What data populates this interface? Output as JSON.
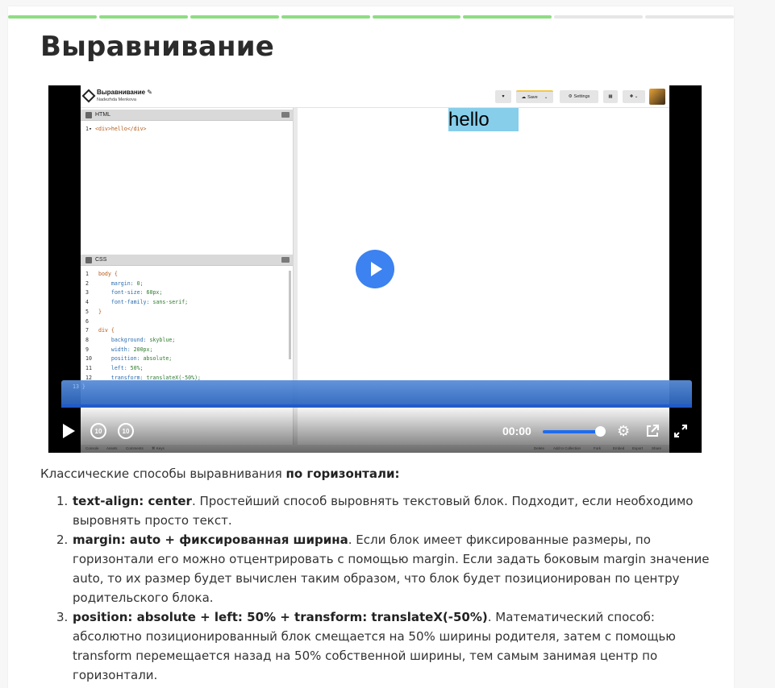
{
  "progress": {
    "segments": [
      "done",
      "done",
      "done",
      "done",
      "done",
      "done",
      "todo",
      "todo"
    ],
    "colors": {
      "done": "#8fdc84",
      "todo": "#e6e6e6"
    }
  },
  "title": "Выравнивание",
  "video": {
    "codepen": {
      "title": "Выравнивание",
      "author": "Nadezhda Menkova",
      "buttons": {
        "save": "Save",
        "settings": "Settings"
      },
      "html_pane": "HTML",
      "css_pane": "CSS",
      "html_code": [
        {
          "n": "1",
          "text": "<div>hello</div>"
        }
      ],
      "css_code": [
        {
          "n": "1",
          "sel": "body {",
          "prop": "",
          "val": ""
        },
        {
          "n": "2",
          "sel": "",
          "prop": "margin:",
          "val": " 0;"
        },
        {
          "n": "3",
          "sel": "",
          "prop": "font-size:",
          "val": " 60px;"
        },
        {
          "n": "4",
          "sel": "",
          "prop": "font-family:",
          "val": " sans-serif;"
        },
        {
          "n": "5",
          "sel": "}",
          "prop": "",
          "val": ""
        },
        {
          "n": "6",
          "sel": "",
          "prop": "",
          "val": ""
        },
        {
          "n": "7",
          "sel": "div {",
          "prop": "",
          "val": ""
        },
        {
          "n": "8",
          "sel": "",
          "prop": "background:",
          "val": " skyblue;"
        },
        {
          "n": "9",
          "sel": "",
          "prop": "width:",
          "val": " 200px;"
        },
        {
          "n": "10",
          "sel": "",
          "prop": "position:",
          "val": " absolute;"
        },
        {
          "n": "11",
          "sel": "",
          "prop": "left:",
          "val": " 50%;"
        },
        {
          "n": "12",
          "sel": "",
          "prop": "transform:",
          "val": " translateX(-50%);"
        }
      ],
      "wave_line_number": "13  }",
      "preview_text": "hello",
      "footer": {
        "console": "Console",
        "assets": "Assets",
        "comments": "Comments",
        "keys": "⌘ Keys",
        "delete": "Delete",
        "collection": "Add to Collection",
        "fork": "Fork",
        "embed": "Embed",
        "export": "Export",
        "share": "Share"
      }
    },
    "controls": {
      "rewind": "10",
      "forward": "10",
      "time": "00:00",
      "volume": 0.9
    }
  },
  "content": {
    "intro_plain": "Классические способы выравнивания ",
    "intro_bold": "по горизонтали:",
    "items": [
      {
        "num": "1.",
        "bold": "text-align: center",
        "text": ". Простейший способ выровнять текстовый блок. Подходит, если необходимо выровнять просто текст."
      },
      {
        "num": "2.",
        "bold": "margin: auto + фиксированная ширина",
        "text": ". Если блок имеет фиксированные размеры, по горизонтали его можно отцентрировать с помощью margin. Если задать боковым margin значение auto, то их размер будет вычислен таким образом, что блок будет позиционирован по центру родительского блока."
      },
      {
        "num": "3.",
        "bold": "position: absolute + left: 50% + transform: translateX(-50%)",
        "text": ". Математический способ: абсолютно позиционированный блок смещается на 50% ширины родителя, затем с помощью transform перемещается назад на 50% собственной ширины, тем самым занимая центр по горизонтали."
      }
    ]
  }
}
